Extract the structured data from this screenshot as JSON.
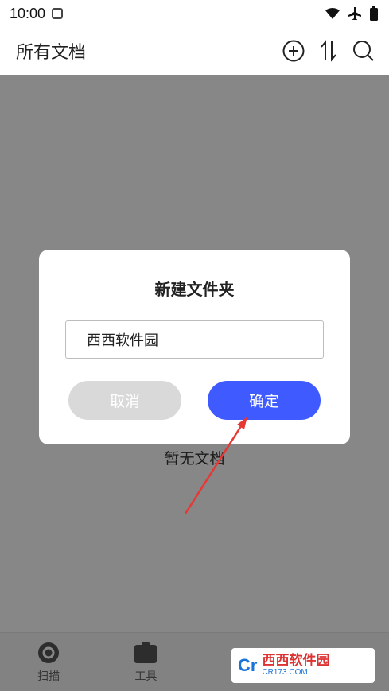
{
  "status_bar": {
    "time": "10:00"
  },
  "app_bar": {
    "title": "所有文档",
    "icons": [
      "add-circle-icon",
      "sort-icon",
      "search-icon"
    ]
  },
  "main": {
    "empty_text": "暂无文档"
  },
  "bottom_nav": {
    "items": [
      {
        "label": "扫描",
        "icon": "scan-icon"
      },
      {
        "label": "工具",
        "icon": "tools-icon"
      },
      {
        "label": "",
        "icon": "folder-icon"
      },
      {
        "label": "",
        "icon": "profile-icon"
      }
    ]
  },
  "dialog": {
    "title": "新建文件夹",
    "input_value": "西西软件园",
    "cancel_label": "取消",
    "ok_label": "确定"
  },
  "watermark": {
    "logo": "Cr",
    "name": "西西软件园",
    "site": "CR173.COM"
  },
  "colors": {
    "primary": "#3f5bff",
    "cancel": "#d9d9d9",
    "annotation_arrow": "#e53935"
  }
}
